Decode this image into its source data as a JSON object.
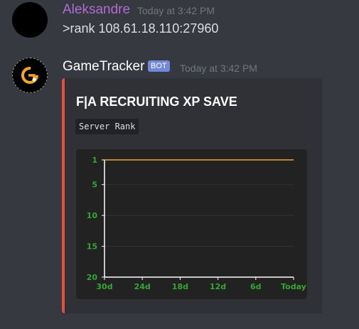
{
  "messages": [
    {
      "author": "Aleksandre",
      "author_color": "#b06bd4",
      "timestamp": "Today at 3:42 PM",
      "content": ">rank 108.61.18.110:27960"
    },
    {
      "author": "GameTracker",
      "author_color": "#ffffff",
      "bot_tag": "BOT",
      "timestamp": "Today at 3:42 PM",
      "avatar_icon": "gametracker-logo-icon",
      "embed": {
        "accent_color": "#e74c3c",
        "title": "F|A RECRUITING XP SAVE",
        "description_code": "Server Rank"
      }
    }
  ],
  "chart_data": {
    "type": "line",
    "title": "",
    "xlabel": "",
    "ylabel": "",
    "categories": [
      "30d",
      "24d",
      "18d",
      "12d",
      "6d",
      "Today"
    ],
    "y_ticks": [
      1,
      5,
      10,
      15,
      20
    ],
    "ylim": [
      1,
      20
    ],
    "y_inverted": true,
    "grid": true,
    "series": [
      {
        "values": [
          1,
          1,
          1,
          1,
          1,
          1
        ],
        "color": "#f0a830"
      }
    ],
    "colors": {
      "axis": "#ffffff",
      "ticks": "#32a832",
      "grid": "#333333"
    }
  }
}
